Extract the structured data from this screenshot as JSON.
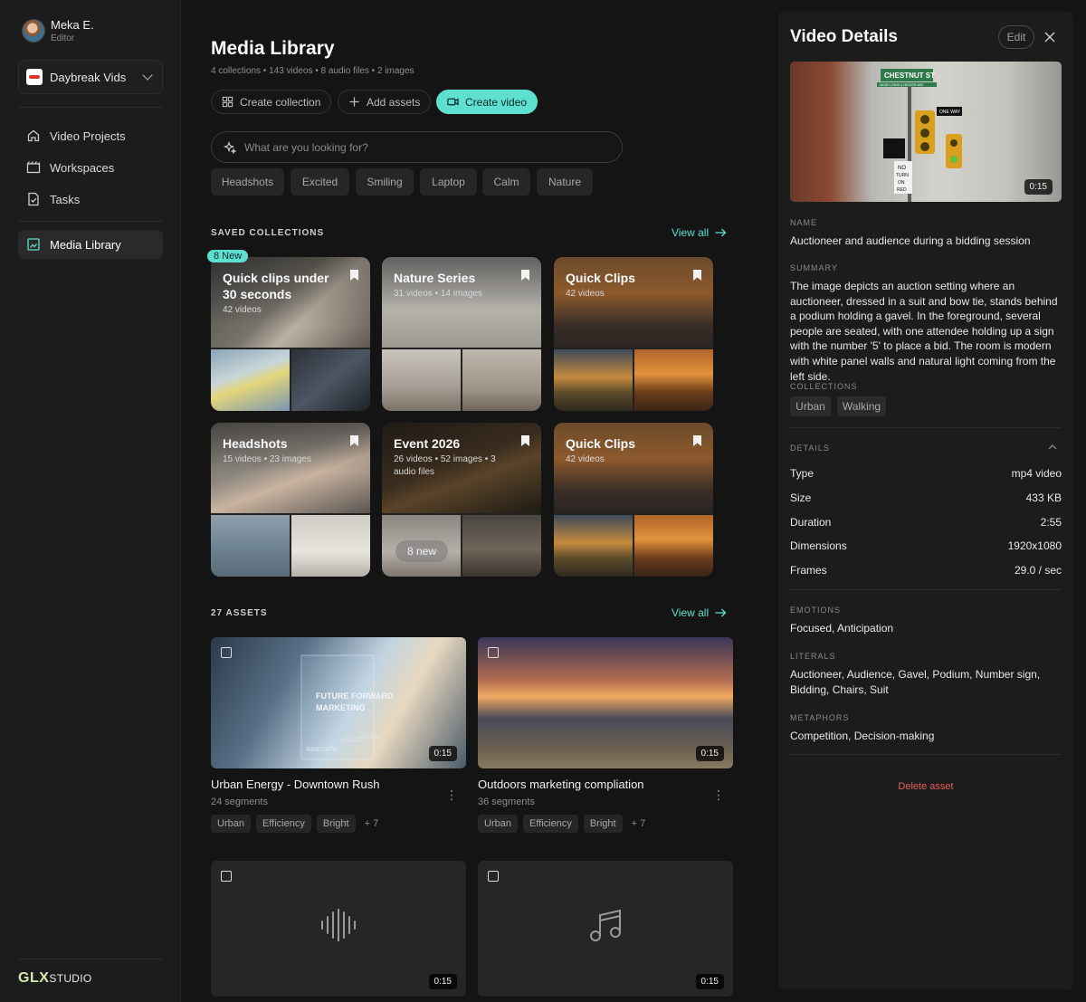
{
  "user": {
    "name": "Meka E.",
    "role": "Editor"
  },
  "workspace": {
    "name": "Daybreak Vids"
  },
  "nav": [
    {
      "label": "Video Projects",
      "icon": "home-icon"
    },
    {
      "label": "Workspaces",
      "icon": "clapperboard-icon"
    },
    {
      "label": "Tasks",
      "icon": "task-icon"
    },
    {
      "label": "Media Library",
      "icon": "image-icon",
      "active": true
    }
  ],
  "brand": {
    "main": "GLX",
    "sub": "STUDIO"
  },
  "library": {
    "title": "Media Library",
    "subtitle": "4 collections • 143 videos • 8 audio files • 2 images",
    "buttons": {
      "create_collection": "Create collection",
      "add_assets": "Add assets",
      "create_video": "Create video"
    },
    "search_placeholder": "What are you looking for?",
    "chips": [
      "Headshots",
      "Excited",
      "Smiling",
      "Laptop",
      "Calm",
      "Nature"
    ],
    "saved_collections_label": "SAVED COLLECTIONS",
    "view_all": "View all",
    "collections": [
      {
        "title": "Quick clips under 30 seconds",
        "meta": "42 videos",
        "badge": "8 New"
      },
      {
        "title": "Nature Series",
        "meta": "31 videos • 14 images"
      },
      {
        "title": "Quick Clips",
        "meta": "42 videos"
      },
      {
        "title": "Headshots",
        "meta": "15 videos • 23 images"
      },
      {
        "title": "Event 2026",
        "meta": "26 videos • 52 images • 3 audio files",
        "overlay": "8 new"
      },
      {
        "title": "Quick Clips",
        "meta": "42 videos"
      }
    ],
    "assets_label": "27 ASSETS",
    "assets": [
      {
        "title": "Urban Energy - Downtown Rush",
        "segments": "24 segments",
        "duration": "0:15",
        "tags": [
          "Urban",
          "Efficiency",
          "Bright"
        ],
        "more": "+ 7",
        "overlay_text": [
          "FUTURE FORWARD",
          "MARKETING",
          "INNOVATE",
          "CREATE",
          "GROW"
        ]
      },
      {
        "title": "Outdoors marketing compliation",
        "segments": "36 segments",
        "duration": "0:15",
        "tags": [
          "Urban",
          "Efficiency",
          "Bright"
        ],
        "more": "+ 7"
      },
      {
        "duration": "0:15",
        "icon": "waveform-icon"
      },
      {
        "duration": "0:15",
        "icon": "music-note-icon"
      }
    ]
  },
  "details": {
    "title": "Video Details",
    "edit": "Edit",
    "hero_duration": "0:15",
    "hero_signs": {
      "street": "CHESTNUT ST",
      "street_sub": "JUDGE LEWIS & HECKER WAY",
      "oneway": "ONE WAY",
      "no_turn": [
        "NO",
        "TURN",
        "ON",
        "RED"
      ]
    },
    "name_label": "NAME",
    "name": "Auctioneer and audience during a bidding session",
    "summary_label": "SUMMARY",
    "summary": "The image depicts an auction setting where an auctioneer, dressed in a suit and bow tie, stands behind a podium holding a gavel. In the foreground, several people are seated, with one attendee holding up a sign with the number '5' to place a bid. The room is modern with white panel walls and natural light coming from the left side.",
    "collections_label": "COLLECTIONS",
    "collections": [
      "Urban",
      "Walking"
    ],
    "details_label": "DETAILS",
    "rows": [
      {
        "k": "Type",
        "v": "mp4 video"
      },
      {
        "k": "Size",
        "v": "433 KB"
      },
      {
        "k": "Duration",
        "v": "2:55"
      },
      {
        "k": "Dimensions",
        "v": "1920x1080"
      },
      {
        "k": "Frames",
        "v": "29.0 / sec"
      }
    ],
    "emotions_label": "EMOTIONS",
    "emotions": "Focused, Anticipation",
    "literals_label": "LITERALS",
    "literals": "Auctioneer, Audience, Gavel, Podium, Number sign, Bidding, Chairs, Suit",
    "metaphors_label": "METAPHORS",
    "metaphors": "Competition, Decision-making",
    "delete": "Delete asset"
  },
  "colors": {
    "accent": "#5ee0d0",
    "danger": "#e85c5c",
    "background": "#141414",
    "panel": "#1c1c1c"
  }
}
